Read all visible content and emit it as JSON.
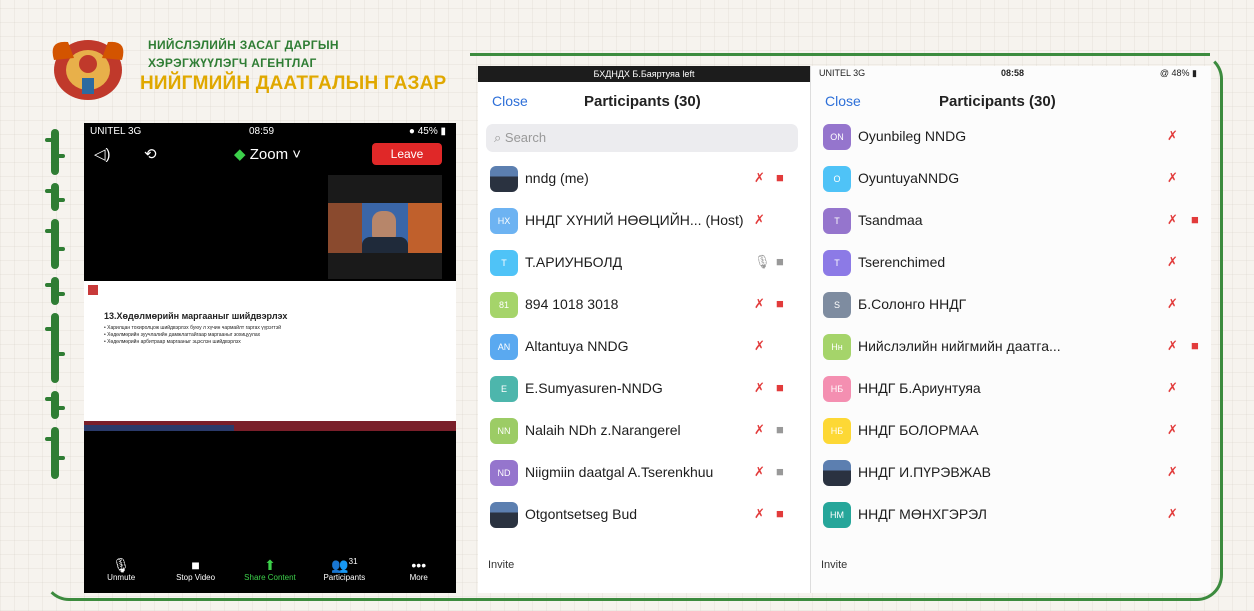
{
  "org": {
    "line1": "НИЙСЛЭЛИЙН ЗАСАГ ДАРГЫН",
    "line2": "ХЭРЭГЖҮҮЛЭГЧ АГЕНТЛАГ",
    "line3": "НИЙГМИЙН ДААТГАЛЫН ГАЗАР"
  },
  "phone1": {
    "carrier": "UNITEL 3G",
    "time": "08:59",
    "battery": "45%",
    "app_title": "Zoom",
    "leave_label": "Leave",
    "slide": {
      "title": "13.Хөдөлмөрийн маргааныг шийдвэрлэх",
      "bullets": [
        "Харилцан тохиролцож шийдвэрлэх буюу л хүчин чармайлт гаргах үүрэгтэй",
        "Хөдөлмөрийн зуучлалийн дамжлагтайгаар маргааныг зохицуулах",
        "Хөдөлмөрийн арбитраар маргааныг эцэслэн шийдвэрлэх"
      ]
    },
    "toolbar": [
      {
        "label": "Unmute",
        "icon": "mic-off-icon",
        "glyph": "🎙"
      },
      {
        "label": "Stop Video",
        "icon": "video-icon",
        "glyph": "■"
      },
      {
        "label": "Share Content",
        "icon": "share-icon",
        "glyph": "⬆"
      },
      {
        "label": "Participants",
        "icon": "participants-icon",
        "glyph": "👥",
        "badge": "31"
      },
      {
        "label": "More",
        "icon": "more-icon",
        "glyph": "•••"
      }
    ]
  },
  "panel2": {
    "banner": "БХДНДХ Б.Баяртуяа left",
    "close_label": "Close",
    "title": "Participants (30)",
    "search_placeholder": "Search",
    "invite_label": "Invite",
    "participants": [
      {
        "name": "nndg (me)",
        "initials": "",
        "color": "#4a6fa5",
        "photo": true,
        "mic": "muted",
        "video": "off"
      },
      {
        "name": "ННДГ ХҮНИЙ НӨӨЦИЙН...  (Host)",
        "initials": "НХ",
        "color": "#6db3f2",
        "mic": "muted",
        "video": ""
      },
      {
        "name": "Т.АРИУНБОЛД",
        "initials": "Т",
        "color": "#4fc3f7",
        "mic": "on",
        "video": "on"
      },
      {
        "name": "894 1018 3018",
        "initials": "81",
        "color": "#a5d46a",
        "mic": "muted",
        "video": "off"
      },
      {
        "name": "Altantuya NNDG",
        "initials": "AN",
        "color": "#5aa9f0",
        "mic": "muted",
        "video": ""
      },
      {
        "name": "E.Sumyasuren-NNDG",
        "initials": "E",
        "color": "#4db6ac",
        "mic": "muted",
        "video": "off"
      },
      {
        "name": "Nalaih NDh z.Narangerel",
        "initials": "NN",
        "color": "#9ccc65",
        "mic": "muted",
        "video": "on"
      },
      {
        "name": "Niigmiin daatgal A.Tserenkhuu",
        "initials": "ND",
        "color": "#9575cd",
        "mic": "muted",
        "video": "on"
      },
      {
        "name": "Otgontsetseg Bud",
        "initials": "",
        "color": "#7aa0c8",
        "photo": true,
        "mic": "muted",
        "video": "off"
      }
    ]
  },
  "panel3": {
    "carrier": "UNITEL 3G",
    "time": "08:58",
    "battery": "48%",
    "close_label": "Close",
    "title": "Participants (30)",
    "invite_label": "Invite",
    "participants": [
      {
        "name": "Oyunbileg NNDG",
        "initials": "ON",
        "color": "#9575cd",
        "mic": "muted",
        "video": ""
      },
      {
        "name": "OyuntuyaNNDG",
        "initials": "O",
        "color": "#4fc3f7",
        "mic": "muted",
        "video": ""
      },
      {
        "name": "Tsandmaa",
        "initials": "T",
        "color": "#9575cd",
        "mic": "muted",
        "video": "off"
      },
      {
        "name": "Tserenchimed",
        "initials": "T",
        "color": "#8c7ae6",
        "mic": "muted",
        "video": ""
      },
      {
        "name": "Б.Солонго ННДГ",
        "initials": "S",
        "color": "#7e8ca0",
        "mic": "muted",
        "video": ""
      },
      {
        "name": "Нийслэлийн нийгмийн даатга...",
        "initials": "Нн",
        "color": "#a5d46a",
        "mic": "muted",
        "video": "off"
      },
      {
        "name": "ННДГ Б.Ариунтуяа",
        "initials": "НБ",
        "color": "#f48fb1",
        "mic": "muted",
        "video": ""
      },
      {
        "name": "ННДГ БОЛОРМАА",
        "initials": "НБ",
        "color": "#fdd835",
        "mic": "muted",
        "video": ""
      },
      {
        "name": "ННДГ И.ПҮРЭВЖАВ",
        "initials": "",
        "color": "#4a6fa5",
        "photo": true,
        "mic": "muted",
        "video": ""
      },
      {
        "name": "ННДГ МӨНХГЭРЭЛ",
        "initials": "НМ",
        "color": "#26a69a",
        "mic": "muted",
        "video": ""
      }
    ]
  }
}
